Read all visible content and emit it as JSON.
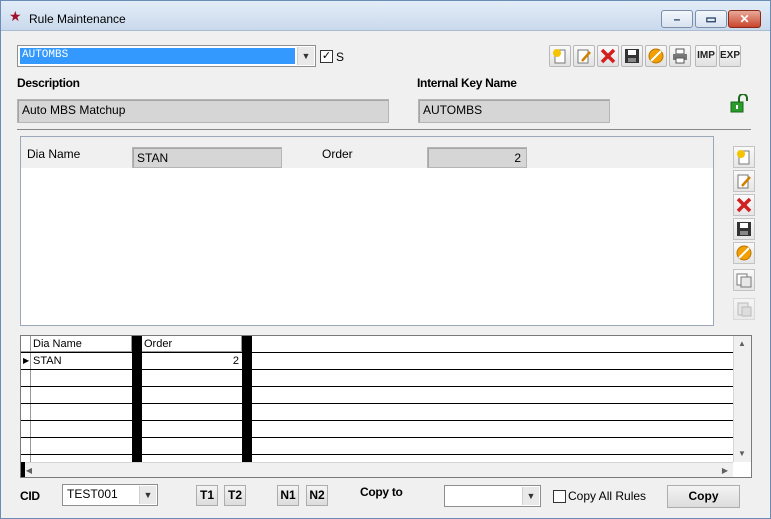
{
  "window": {
    "title": "Rule Maintenance"
  },
  "rule_select": {
    "value": "AUTOMBS",
    "s_checked": true,
    "s_label": "S"
  },
  "toolbar": {
    "imp_label": "IMP",
    "exp_label": "EXP"
  },
  "description": {
    "label": "Description",
    "value": "Auto MBS Matchup"
  },
  "internal_key": {
    "label": "Internal Key Name",
    "value": "AUTOMBS"
  },
  "detail": {
    "dia_name_label": "Dia Name",
    "dia_name_value": "STAN",
    "order_label": "Order",
    "order_value": "2"
  },
  "grid": {
    "columns": [
      "Dia Name",
      "Order"
    ],
    "rows": [
      {
        "dia_name": "STAN",
        "order": "2"
      }
    ]
  },
  "footer": {
    "cid_label": "CID",
    "cid_value": "TEST001",
    "t1": "T1",
    "t2": "T2",
    "n1": "N1",
    "n2": "N2",
    "copy_to_label": "Copy to",
    "copy_to_value": "",
    "copy_all_label": "Copy All Rules",
    "copy_all_checked": false,
    "copy_button": "Copy"
  },
  "colors": {
    "selection": "#3399ff",
    "field_bg": "#d6d6d6",
    "lock": "#2a9a2a"
  }
}
